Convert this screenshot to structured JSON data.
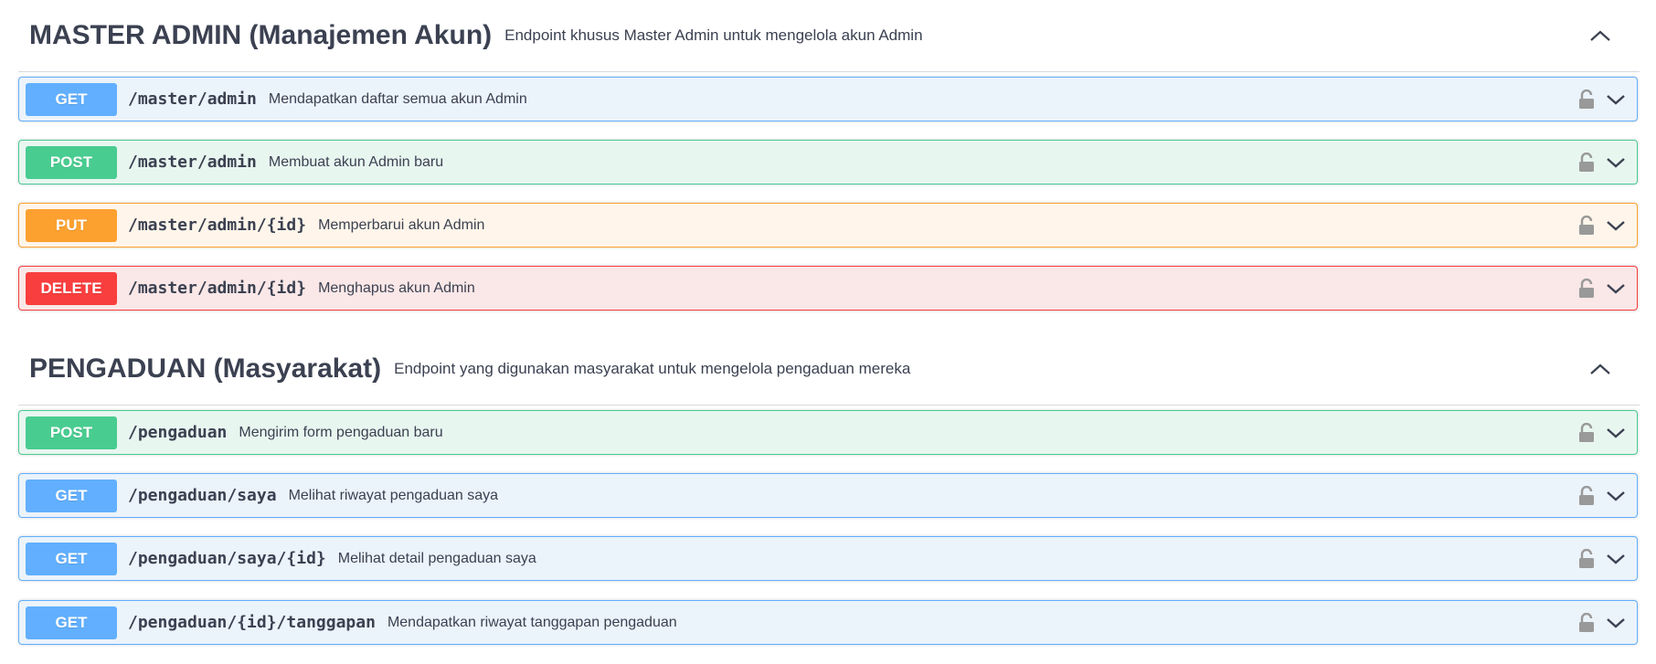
{
  "sections": [
    {
      "title": "MASTER ADMIN (Manajemen Akun)",
      "description": "Endpoint khusus Master Admin untuk mengelola akun Admin",
      "toggle_icon": "chevron-up-icon",
      "operations": [
        {
          "method": "GET",
          "path": "/master/admin",
          "summary": "Mendapatkan daftar semua akun Admin"
        },
        {
          "method": "POST",
          "path": "/master/admin",
          "summary": "Membuat akun Admin baru"
        },
        {
          "method": "PUT",
          "path": "/master/admin/{id}",
          "summary": "Memperbarui akun Admin"
        },
        {
          "method": "DELETE",
          "path": "/master/admin/{id}",
          "summary": "Menghapus akun Admin"
        }
      ]
    },
    {
      "title": "PENGADUAN (Masyarakat)",
      "description": "Endpoint yang digunakan masyarakat untuk mengelola pengaduan mereka",
      "toggle_icon": "chevron-up-icon",
      "operations": [
        {
          "method": "POST",
          "path": "/pengaduan",
          "summary": "Mengirim form pengaduan baru"
        },
        {
          "method": "GET",
          "path": "/pengaduan/saya",
          "summary": "Melihat riwayat pengaduan saya"
        },
        {
          "method": "GET",
          "path": "/pengaduan/saya/{id}",
          "summary": "Melihat detail pengaduan saya"
        },
        {
          "method": "GET",
          "path": "/pengaduan/{id}/tanggapan",
          "summary": "Mendapatkan riwayat tanggapan pengaduan"
        }
      ]
    }
  ],
  "icons": {
    "lock": "unlocked-padlock-icon",
    "expand": "chevron-down-icon"
  },
  "colors": {
    "get": "#61affe",
    "post": "#49cc90",
    "put": "#fca130",
    "delete": "#f93e3e"
  }
}
